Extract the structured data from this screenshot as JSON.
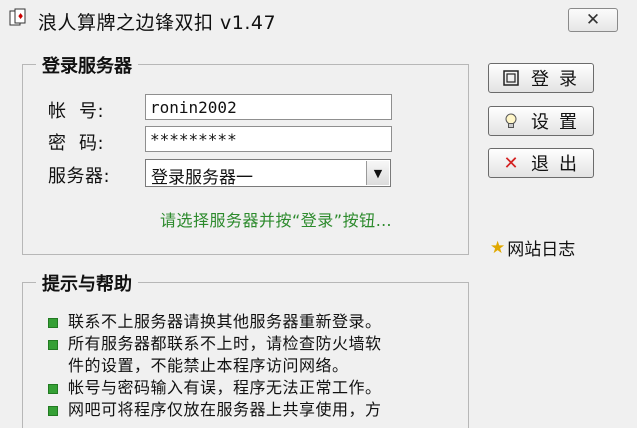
{
  "window": {
    "title": "浪人算牌之边锋双扣 v1.47",
    "close_glyph": "✕"
  },
  "login": {
    "legend": "登录服务器",
    "account_label": "帐  号:",
    "account_value": "ronin2002",
    "password_label": "密  码:",
    "password_value": "*********",
    "server_label": "服务器:",
    "server_value": "登录服务器一",
    "hint": "请选择服务器并按“登录”按钮…"
  },
  "buttons": {
    "login": "登录",
    "settings": "设置",
    "exit": "退出"
  },
  "journal": "网站日志",
  "help": {
    "legend": "提示与帮助",
    "items": [
      "联系不上服务器请换其他服务器重新登录。",
      "所有服务器都联系不上时，请检查防火墙软",
      "件的设置，不能禁止本程序访问网络。",
      "帐号与密码输入有误，程序无法正常工作。",
      "网吧可将程序仅放在服务器上共享使用，方"
    ]
  },
  "colors": {
    "hint_green": "#2c8a2c",
    "bullet_green": "#35a035",
    "exit_red": "#d42020",
    "star": "#e0a800"
  },
  "icons": [
    "app-icon",
    "close-icon",
    "login-icon",
    "settings-bulb-icon",
    "exit-x-icon",
    "star-icon",
    "bullet-icon"
  ]
}
